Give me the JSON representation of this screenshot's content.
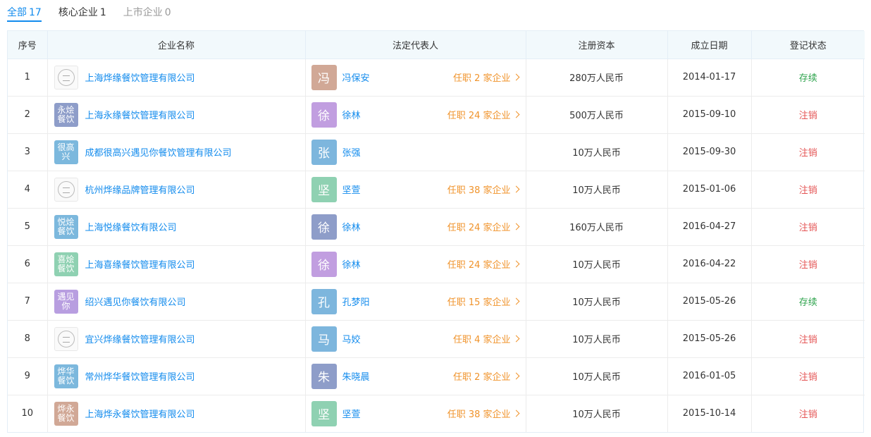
{
  "tabs": [
    {
      "label": "全部",
      "count": "17",
      "state": "active"
    },
    {
      "label": "核心企业",
      "count": "1",
      "state": "normal"
    },
    {
      "label": "上市企业",
      "count": "0",
      "state": "disabled"
    }
  ],
  "table": {
    "headers": [
      "序号",
      "企业名称",
      "法定代表人",
      "注册资本",
      "成立日期",
      "登记状态"
    ],
    "rows": [
      {
        "idx": "1",
        "logo_text": "",
        "logo_type": "image",
        "logo_icon": "brand-logo-icon",
        "logo_color": "",
        "company": "上海烨缘餐饮管理有限公司",
        "avatar": "冯",
        "avatar_color": "#d1a896",
        "rep": "冯保安",
        "positions": "任职 2 家企业",
        "capital": "280万人民币",
        "date": "2014-01-17",
        "status": "存续",
        "status_type": "active"
      },
      {
        "idx": "2",
        "logo_text": "永烩餐饮",
        "logo_type": "text",
        "logo_icon": "",
        "logo_color": "#8e9dc9",
        "company": "上海永缘餐饮管理有限公司",
        "avatar": "徐",
        "avatar_color": "#c19ee0",
        "rep": "徐林",
        "positions": "任职 24 家企业",
        "capital": "500万人民币",
        "date": "2015-09-10",
        "status": "注销",
        "status_type": "cancel"
      },
      {
        "idx": "3",
        "logo_text": "很高兴",
        "logo_type": "text",
        "logo_icon": "",
        "logo_color": "#7cb8dd",
        "company": "成都很高兴遇见你餐饮管理有限公司",
        "avatar": "张",
        "avatar_color": "#7db6dd",
        "rep": "张强",
        "positions": "",
        "capital": "10万人民币",
        "date": "2015-09-30",
        "status": "注销",
        "status_type": "cancel"
      },
      {
        "idx": "4",
        "logo_text": "",
        "logo_type": "image",
        "logo_icon": "brand-logo-icon",
        "logo_color": "",
        "company": "杭州烨缘品牌管理有限公司",
        "avatar": "坚",
        "avatar_color": "#8fd1b2",
        "rep": "坚萱",
        "positions": "任职 38 家企业",
        "capital": "10万人民币",
        "date": "2015-01-06",
        "status": "注销",
        "status_type": "cancel"
      },
      {
        "idx": "5",
        "logo_text": "悦烩餐饮",
        "logo_type": "text",
        "logo_icon": "",
        "logo_color": "#7cb8dd",
        "company": "上海悦缘餐饮有限公司",
        "avatar": "徐",
        "avatar_color": "#8e9dc9",
        "rep": "徐林",
        "positions": "任职 24 家企业",
        "capital": "160万人民币",
        "date": "2016-04-27",
        "status": "注销",
        "status_type": "cancel"
      },
      {
        "idx": "6",
        "logo_text": "喜烩餐饮",
        "logo_type": "text",
        "logo_icon": "",
        "logo_color": "#8fd1b2",
        "company": "上海喜缘餐饮管理有限公司",
        "avatar": "徐",
        "avatar_color": "#c19ee0",
        "rep": "徐林",
        "positions": "任职 24 家企业",
        "capital": "10万人民币",
        "date": "2016-04-22",
        "status": "注销",
        "status_type": "cancel"
      },
      {
        "idx": "7",
        "logo_text": "遇见你",
        "logo_type": "text",
        "logo_icon": "",
        "logo_color": "#b89ee0",
        "company": "绍兴遇见你餐饮有限公司",
        "avatar": "孔",
        "avatar_color": "#7db6dd",
        "rep": "孔梦阳",
        "positions": "任职 15 家企业",
        "capital": "10万人民币",
        "date": "2015-05-26",
        "status": "存续",
        "status_type": "active"
      },
      {
        "idx": "8",
        "logo_text": "",
        "logo_type": "image",
        "logo_icon": "brand-logo-icon",
        "logo_color": "",
        "company": "宜兴烨缘餐饮管理有限公司",
        "avatar": "马",
        "avatar_color": "#7db6dd",
        "rep": "马姣",
        "positions": "任职 4 家企业",
        "capital": "10万人民币",
        "date": "2015-05-26",
        "status": "注销",
        "status_type": "cancel"
      },
      {
        "idx": "9",
        "logo_text": "烨华餐饮",
        "logo_type": "text",
        "logo_icon": "",
        "logo_color": "#7cb8dd",
        "company": "常州烨华餐饮管理有限公司",
        "avatar": "朱",
        "avatar_color": "#8e9dc9",
        "rep": "朱晓晨",
        "positions": "任职 2 家企业",
        "capital": "10万人民币",
        "date": "2016-01-05",
        "status": "注销",
        "status_type": "cancel"
      },
      {
        "idx": "10",
        "logo_text": "烨永餐饮",
        "logo_type": "text",
        "logo_icon": "",
        "logo_color": "#d1a896",
        "company": "上海烨永餐饮管理有限公司",
        "avatar": "坚",
        "avatar_color": "#8fd1b2",
        "rep": "坚萱",
        "positions": "任职 38 家企业",
        "capital": "10万人民币",
        "date": "2015-10-14",
        "status": "注销",
        "status_type": "cancel"
      }
    ]
  }
}
